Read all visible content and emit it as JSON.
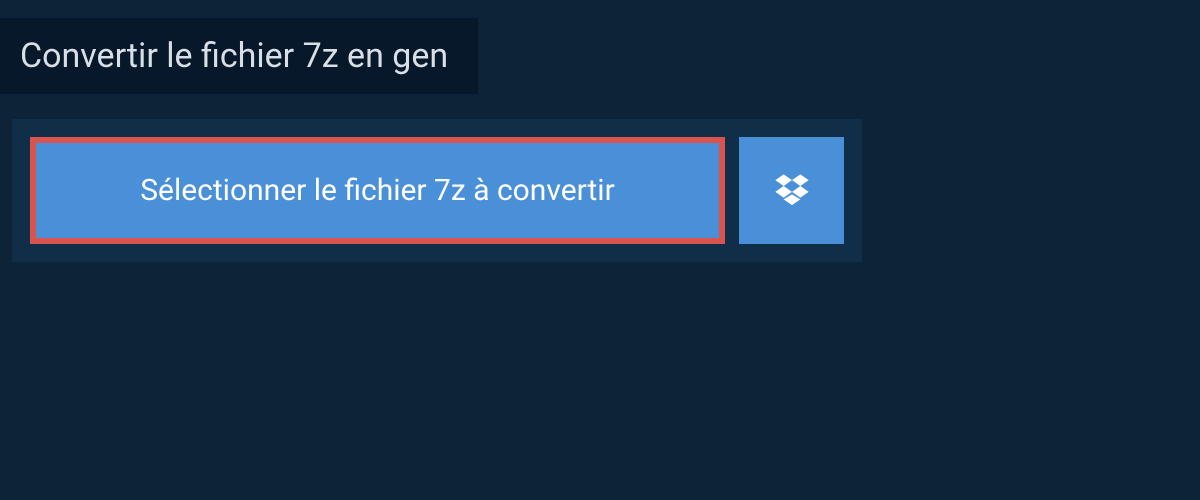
{
  "header": {
    "title": "Convertir le fichier 7z en gen"
  },
  "upload": {
    "select_label": "Sélectionner le fichier 7z à convertir"
  },
  "colors": {
    "bg_dark": "#0d2438",
    "bg_darker": "#06182a",
    "panel": "#112e48",
    "button_blue": "#4a90d9",
    "highlight_red": "#d9544f"
  }
}
